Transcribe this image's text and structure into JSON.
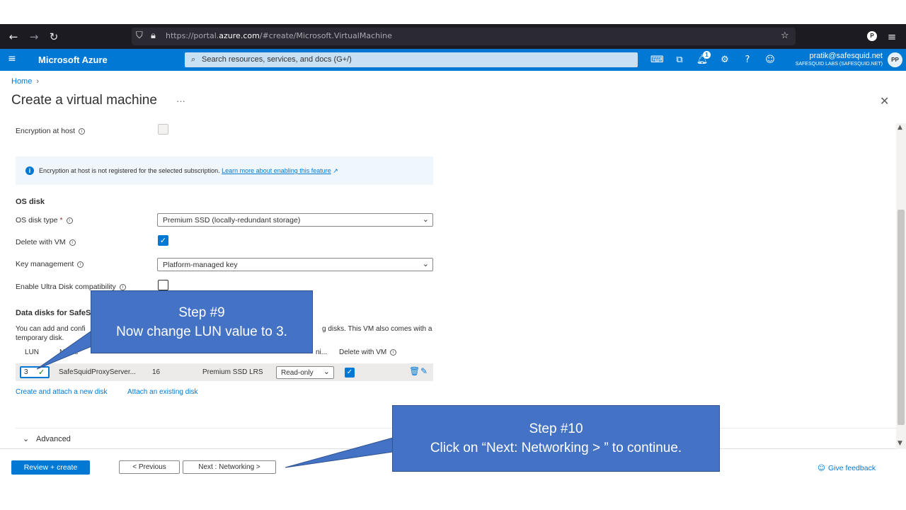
{
  "browser": {
    "url_prefix": "https://portal.",
    "url_domain": "azure.com",
    "url_rest": "/#create/Microsoft.VirtualMachine"
  },
  "header": {
    "brand": "Microsoft Azure",
    "search_placeholder": "Search resources, services, and docs (G+/)",
    "notification_count": "1",
    "user_email": "pratik@safesquid.net",
    "user_org": "SAFESQUID LABS (SAFESQUID.NET)",
    "avatar_initials": "PP"
  },
  "breadcrumb": {
    "home": "Home"
  },
  "page": {
    "title": "Create a virtual machine",
    "more": "···"
  },
  "form": {
    "encryption_label": "Encryption at host",
    "info_banner": "Encryption at host is not registered for the selected subscription.",
    "info_link": "Learn more about enabling this feature",
    "os_disk_section": "OS disk",
    "os_disk_type_label": "OS disk type",
    "os_disk_type_value": "Premium SSD (locally-redundant storage)",
    "delete_with_vm_label": "Delete with VM",
    "key_mgmt_label": "Key management",
    "key_mgmt_value": "Platform-managed key",
    "ultra_disk_label": "Enable Ultra Disk compatibility",
    "data_disks_title": "Data disks for SafeSc",
    "data_disks_desc_a": "You can add and confi",
    "data_disks_desc_b": "g disks. This VM also comes with a",
    "data_disks_desc_c": "temporary disk."
  },
  "table": {
    "headers": {
      "lun": "LUN",
      "name": "Name",
      "host_caching": "ni...",
      "delete": "Delete with VM"
    },
    "row": {
      "lun": "3",
      "name": "SafeSquidProxyServer...",
      "size": "16",
      "type": "Premium SSD LRS",
      "caching": "Read-only"
    }
  },
  "links": {
    "create_disk": "Create and attach a new disk",
    "attach_disk": "Attach an existing disk"
  },
  "advanced": {
    "label": "Advanced"
  },
  "footer": {
    "review_create": "Review + create",
    "previous": "< Previous",
    "next": "Next : Networking >",
    "feedback": "Give feedback"
  },
  "callouts": {
    "step9_title": "Step #9",
    "step9_text": "Now change LUN  value to 3.",
    "step10_title": "Step #10",
    "step10_text": "Click on “Next: Networking > ” to continue."
  },
  "colors": {
    "azure_blue": "#0078d4",
    "callout_fill": "#4472c4",
    "browser_dark": "#1c1b22"
  }
}
